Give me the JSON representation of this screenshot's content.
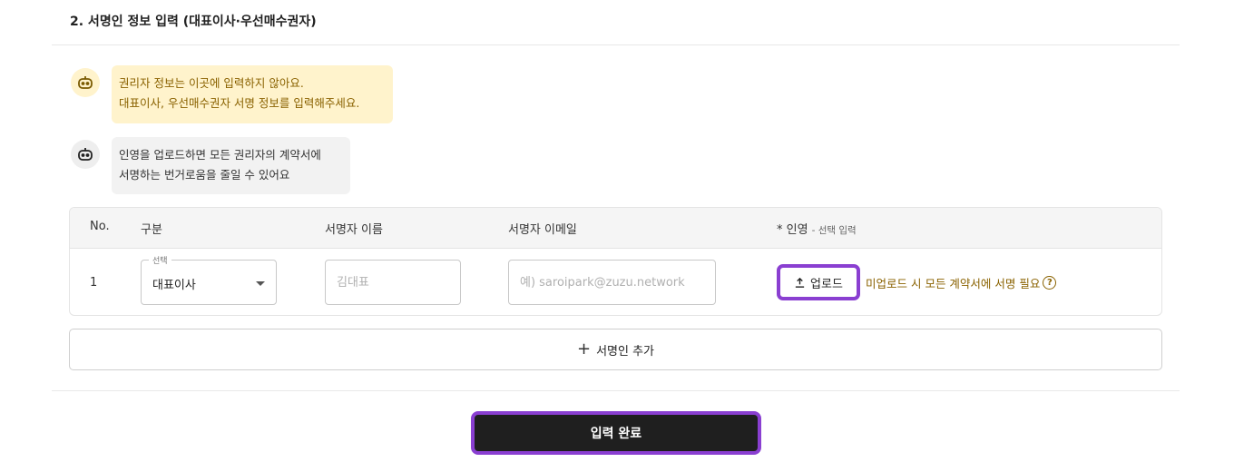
{
  "section": {
    "title": "2. 서명인 정보 입력 (대표이사·우선매수권자)"
  },
  "notices": {
    "yellow": {
      "line1": "권리자 정보는 이곳에 입력하지 않아요.",
      "line2": "대표이사, 우선매수권자 서명 정보를 입력해주세요."
    },
    "gray": {
      "line1": "인영을 업로드하면 모든 권리자의 계약서에",
      "line2": "서명하는 번거로움을 줄일 수 있어요"
    },
    "icon": "robot-icon"
  },
  "table": {
    "headers": {
      "no": "No.",
      "type": "구분",
      "name": "서명자 이름",
      "email": "서명자 이메일",
      "seal": "* 인영",
      "seal_sub": "- 선택 입력"
    },
    "rows": [
      {
        "no": "1",
        "type_label": "선택",
        "type_value": "대표이사",
        "name_placeholder": "김대표",
        "email_placeholder": "예) saroipark@zuzu.network",
        "upload_label": "업로드",
        "upload_note": "미업로드 시 모든 계약서에 서명 필요",
        "help_glyph": "?"
      }
    ]
  },
  "add_button": {
    "icon": "plus-icon",
    "label": "서명인 추가"
  },
  "submit_button": {
    "label": "입력 완료"
  },
  "colors": {
    "notice_yellow_bg": "#fff3cc",
    "notice_yellow_text": "#8a6200",
    "highlight_outline": "#8a3fd1",
    "submit_bg": "#1f1f1f"
  }
}
